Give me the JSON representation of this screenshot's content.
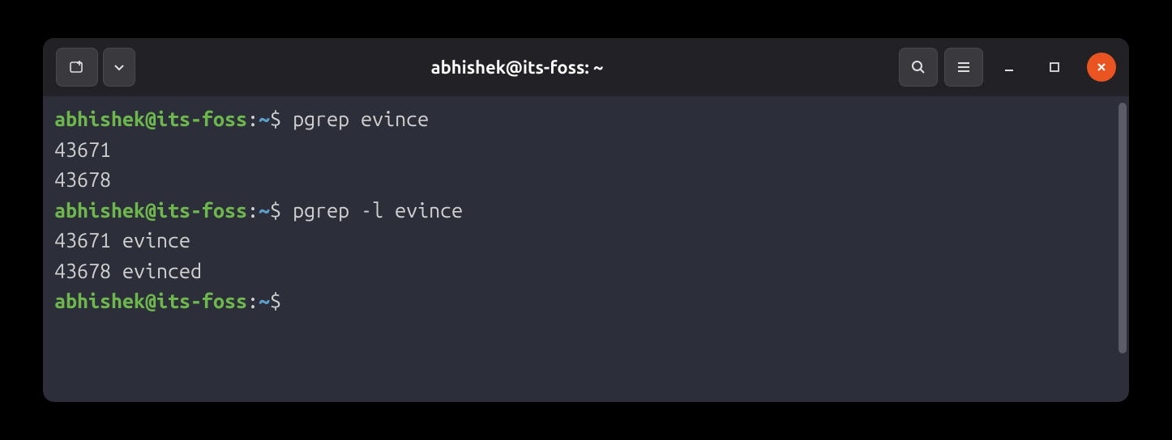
{
  "titlebar": {
    "title": "abhishek@its-foss: ~"
  },
  "prompt": {
    "user_host": "abhishek@its-foss",
    "path": "~",
    "symbol": "$"
  },
  "session": [
    {
      "command": "pgrep evince",
      "output": [
        "43671",
        "43678"
      ]
    },
    {
      "command": "pgrep -l evince",
      "output": [
        "43671 evince",
        "43678 evinced"
      ]
    },
    {
      "command": "",
      "output": []
    }
  ]
}
